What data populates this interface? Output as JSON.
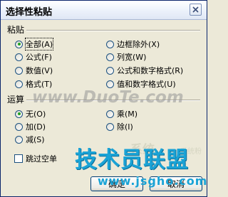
{
  "dialog": {
    "title": "选择性粘贴",
    "close_icon": "close-x-icon"
  },
  "paste": {
    "label": "粘贴",
    "options": [
      {
        "label": "全部(A)",
        "selected": true
      },
      {
        "label": "公式(F)",
        "selected": false
      },
      {
        "label": "数值(V)",
        "selected": false
      },
      {
        "label": "格式(T)",
        "selected": false
      },
      {
        "label": "边框除外(X)",
        "selected": false
      },
      {
        "label": "列宽(W)",
        "selected": false
      },
      {
        "label": "公式和数字格式(R)",
        "selected": false
      },
      {
        "label": "值和数字格式(U)",
        "selected": false
      }
    ]
  },
  "operation": {
    "label": "运算",
    "options": [
      {
        "label": "无(O)",
        "selected": true
      },
      {
        "label": "加(D)",
        "selected": false
      },
      {
        "label": "减(S)",
        "selected": false
      },
      {
        "label": "乘(M)",
        "selected": false
      },
      {
        "label": "除(I)",
        "selected": false
      }
    ]
  },
  "checkbox": {
    "label": "跳过空单",
    "checked": false
  },
  "buttons": {
    "ok": "确定",
    "cancel": "取消"
  },
  "watermarks": {
    "site_text": "www.DuoTe.com",
    "logo_text": "系统",
    "logo_sub": "系统粉",
    "brand_text": "技术员联盟",
    "url_text": "www.jsgho.com"
  }
}
